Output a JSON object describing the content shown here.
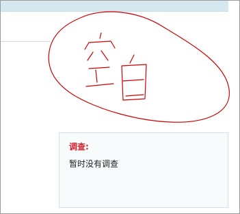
{
  "survey": {
    "title": "调查:",
    "empty_message": "暂时没有调查"
  },
  "annotation": {
    "text": "空白",
    "color": "#d00000"
  },
  "colors": {
    "top_bar": "#d6e9f0",
    "survey_title": "#d61f2a",
    "survey_bg": "#f7fbfc",
    "survey_border": "#cfe2e8"
  }
}
